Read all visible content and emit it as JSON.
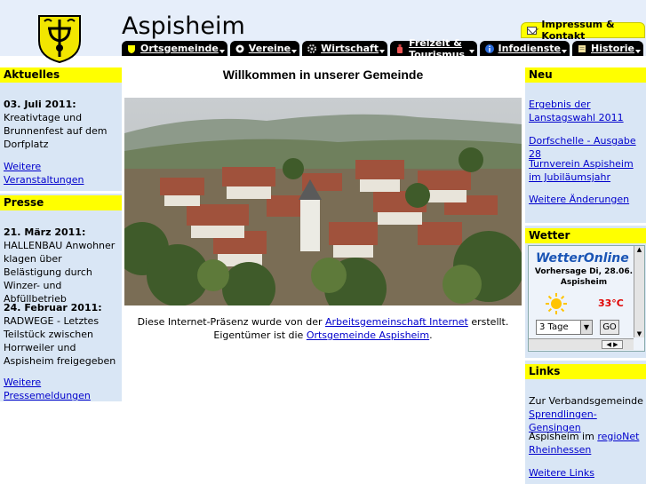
{
  "header": {
    "site_title": "Aspisheim",
    "impressum": "Impressum & Kontakt"
  },
  "nav": {
    "tabs": [
      {
        "label": "Ortsgemeinde",
        "icon": "crest-icon"
      },
      {
        "label": "Vereine",
        "icon": "football-icon"
      },
      {
        "label": "Wirtschaft",
        "icon": "gear-icon"
      },
      {
        "label": "Freizeit & Tourismus",
        "icon": "bottle-icon"
      },
      {
        "label": "Infodienste",
        "icon": "info-icon"
      },
      {
        "label": "Historie",
        "icon": "scroll-icon"
      }
    ]
  },
  "left": {
    "aktuelles_title": "Aktuelles",
    "aktuelles_date": "03. Juli 2011:",
    "aktuelles_text": "Kreativtage und Brunnenfest auf dem Dorfplatz",
    "aktuelles_link": "Weitere Veranstaltungen",
    "presse_title": "Presse",
    "presse_items": [
      {
        "date": "21. März 2011:",
        "text": "HALLENBAU Anwohner klagen über Belästigung durch Winzer- und Abfüllbetrieb"
      },
      {
        "date": "24. Februar 2011:",
        "text": "RADWEGE - Letztes Teilstück zwischen Horrweiler und Aspisheim freigegeben"
      }
    ],
    "presse_link": "Weitere Pressemeldungen"
  },
  "main": {
    "title": "Willkommen in unserer Gemeinde",
    "caption_pre": "Diese Internet-Präsenz wurde von der ",
    "caption_link1": "Arbeitsgemeinschaft Internet",
    "caption_mid": " erstellt.",
    "caption_pre2": "Eigentümer ist die ",
    "caption_link2": "Ortsgemeinde Aspisheim",
    "caption_end": "."
  },
  "right": {
    "neu_title": "Neu",
    "neu_links": [
      "Ergebnis der Lanstagswahl 2011",
      "Dorfschelle - Ausgabe 28",
      "Turnverein Aspisheim im Jubiläumsjahr",
      "Weitere Änderungen"
    ],
    "wetter_title": "Wetter",
    "weather_logo": "WetterOnline",
    "weather_forecast": "Vorhersage Di, 28.06.",
    "weather_place": "Aspisheim",
    "weather_temp": "33°C",
    "weather_select": "3 Tage",
    "weather_go": "GO",
    "links_title": "Links",
    "links_text1": "Zur Verbandsgemeinde",
    "links_link1": "Sprendlingen-Gensingen",
    "links_text2": "Aspisheim im ",
    "links_link2a": "regioNet",
    "links_link2b": "Rheinhessen",
    "links_link3": "Weitere Links"
  },
  "colors": {
    "accent": "#ffff00",
    "sidebar": "#d9e6f5",
    "link": "#0000cc",
    "nav": "#000000"
  }
}
